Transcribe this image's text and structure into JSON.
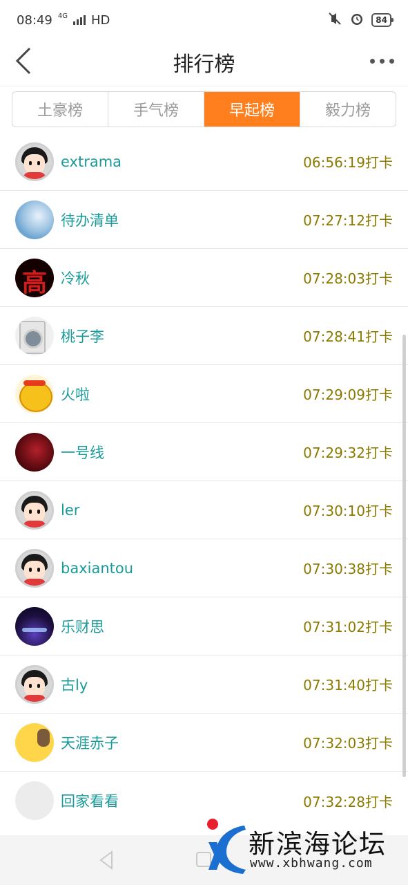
{
  "status_bar": {
    "time": "08:49",
    "network": "4G",
    "hd": "HD",
    "battery": "84"
  },
  "header": {
    "title": "排行榜"
  },
  "tabs": [
    {
      "label": "土豪榜",
      "active": false
    },
    {
      "label": "手气榜",
      "active": false
    },
    {
      "label": "早起榜",
      "active": true
    },
    {
      "label": "毅力榜",
      "active": false
    }
  ],
  "rows": [
    {
      "name": "extrama",
      "time": "06:56:19打卡",
      "avatar": "default-avatar"
    },
    {
      "name": "待办清单",
      "time": "07:27:12打卡",
      "avatar": "blue-photo"
    },
    {
      "name": "冷秋",
      "time": "07:28:03打卡",
      "avatar": "red-character"
    },
    {
      "name": "桃子李",
      "time": "07:28:41打卡",
      "avatar": "washing-machine"
    },
    {
      "name": "火啦",
      "time": "07:29:09打卡",
      "avatar": "yellow-cartoon"
    },
    {
      "name": "一号线",
      "time": "07:29:32打卡",
      "avatar": "dark-red-photo"
    },
    {
      "name": "ler",
      "time": "07:30:10打卡",
      "avatar": "default-avatar"
    },
    {
      "name": "baxiantou",
      "time": "07:30:38打卡",
      "avatar": "default-avatar"
    },
    {
      "name": "乐财思",
      "time": "07:31:02打卡",
      "avatar": "night-photo"
    },
    {
      "name": "古ly",
      "time": "07:31:40打卡",
      "avatar": "default-avatar"
    },
    {
      "name": "天涯赤子",
      "time": "07:32:03打卡",
      "avatar": "cartoon-yellow"
    },
    {
      "name": "回家看看",
      "time": "07:32:28打卡",
      "avatar": "blank-avatar"
    }
  ],
  "watermark": {
    "title": "新滨海论坛",
    "url": "www.xbhwang.com"
  },
  "colors": {
    "accent": "#ff7f1e",
    "name": "#1a9a9a",
    "time": "#8a7a00"
  }
}
